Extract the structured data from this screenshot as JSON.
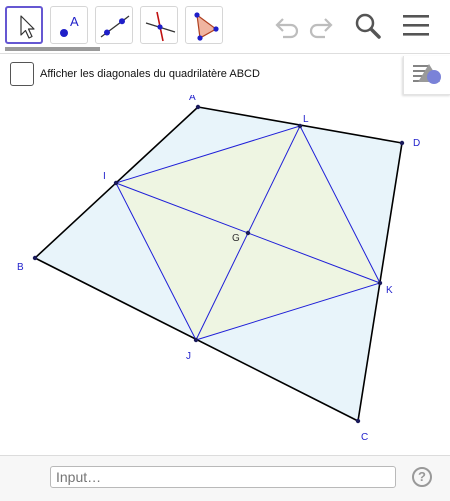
{
  "toolbar": {
    "tools": [
      {
        "name": "move-tool",
        "icon": "cursor-arrow-icon",
        "active": true
      },
      {
        "name": "point-tool",
        "icon": "point-A-icon",
        "label": "A"
      },
      {
        "name": "line-tool",
        "icon": "line-through-points-icon"
      },
      {
        "name": "perpendicular-tool",
        "icon": "perpendicular-line-icon"
      },
      {
        "name": "polygon-tool",
        "icon": "polygon-triangle-icon"
      }
    ],
    "actions": [
      "undo-icon",
      "redo-icon",
      "search-icon",
      "menu-icon"
    ]
  },
  "checkbox": {
    "label": "Afficher les diagonales du quadrilatère ABCD",
    "checked": false
  },
  "points": {
    "A": "A",
    "B": "B",
    "C": "C",
    "D": "D",
    "I": "I",
    "J": "J",
    "K": "K",
    "L": "L",
    "G": "G"
  },
  "colors": {
    "quad_fill": "#e8f4fa",
    "inner_fill": "#eef5e2",
    "quad_stroke": "#000000",
    "inner_stroke": "#1f1fd8",
    "label_color": "#2222cc",
    "accent": "#6557d2"
  },
  "input_bar": {
    "placeholder": "Input…",
    "help_label": "?"
  }
}
